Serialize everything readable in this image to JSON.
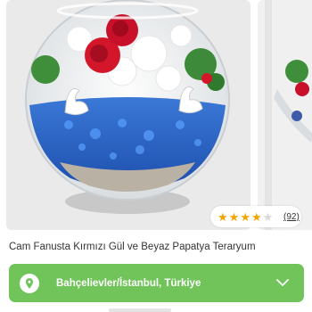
{
  "product": {
    "title": "Cam Fanusta Kırmızı Gül ve Beyaz Papatya Teraryum",
    "rating": 4.5,
    "rating_max": 5,
    "review_count": "(92)"
  },
  "location": {
    "label": "Bahçelievler/İstanbul, Türkiye"
  },
  "colors": {
    "accent_green": "#70c45a",
    "star": "#f0a500"
  },
  "icons": {
    "location": "map-pin-icon",
    "dropdown": "chevron-down-icon"
  }
}
